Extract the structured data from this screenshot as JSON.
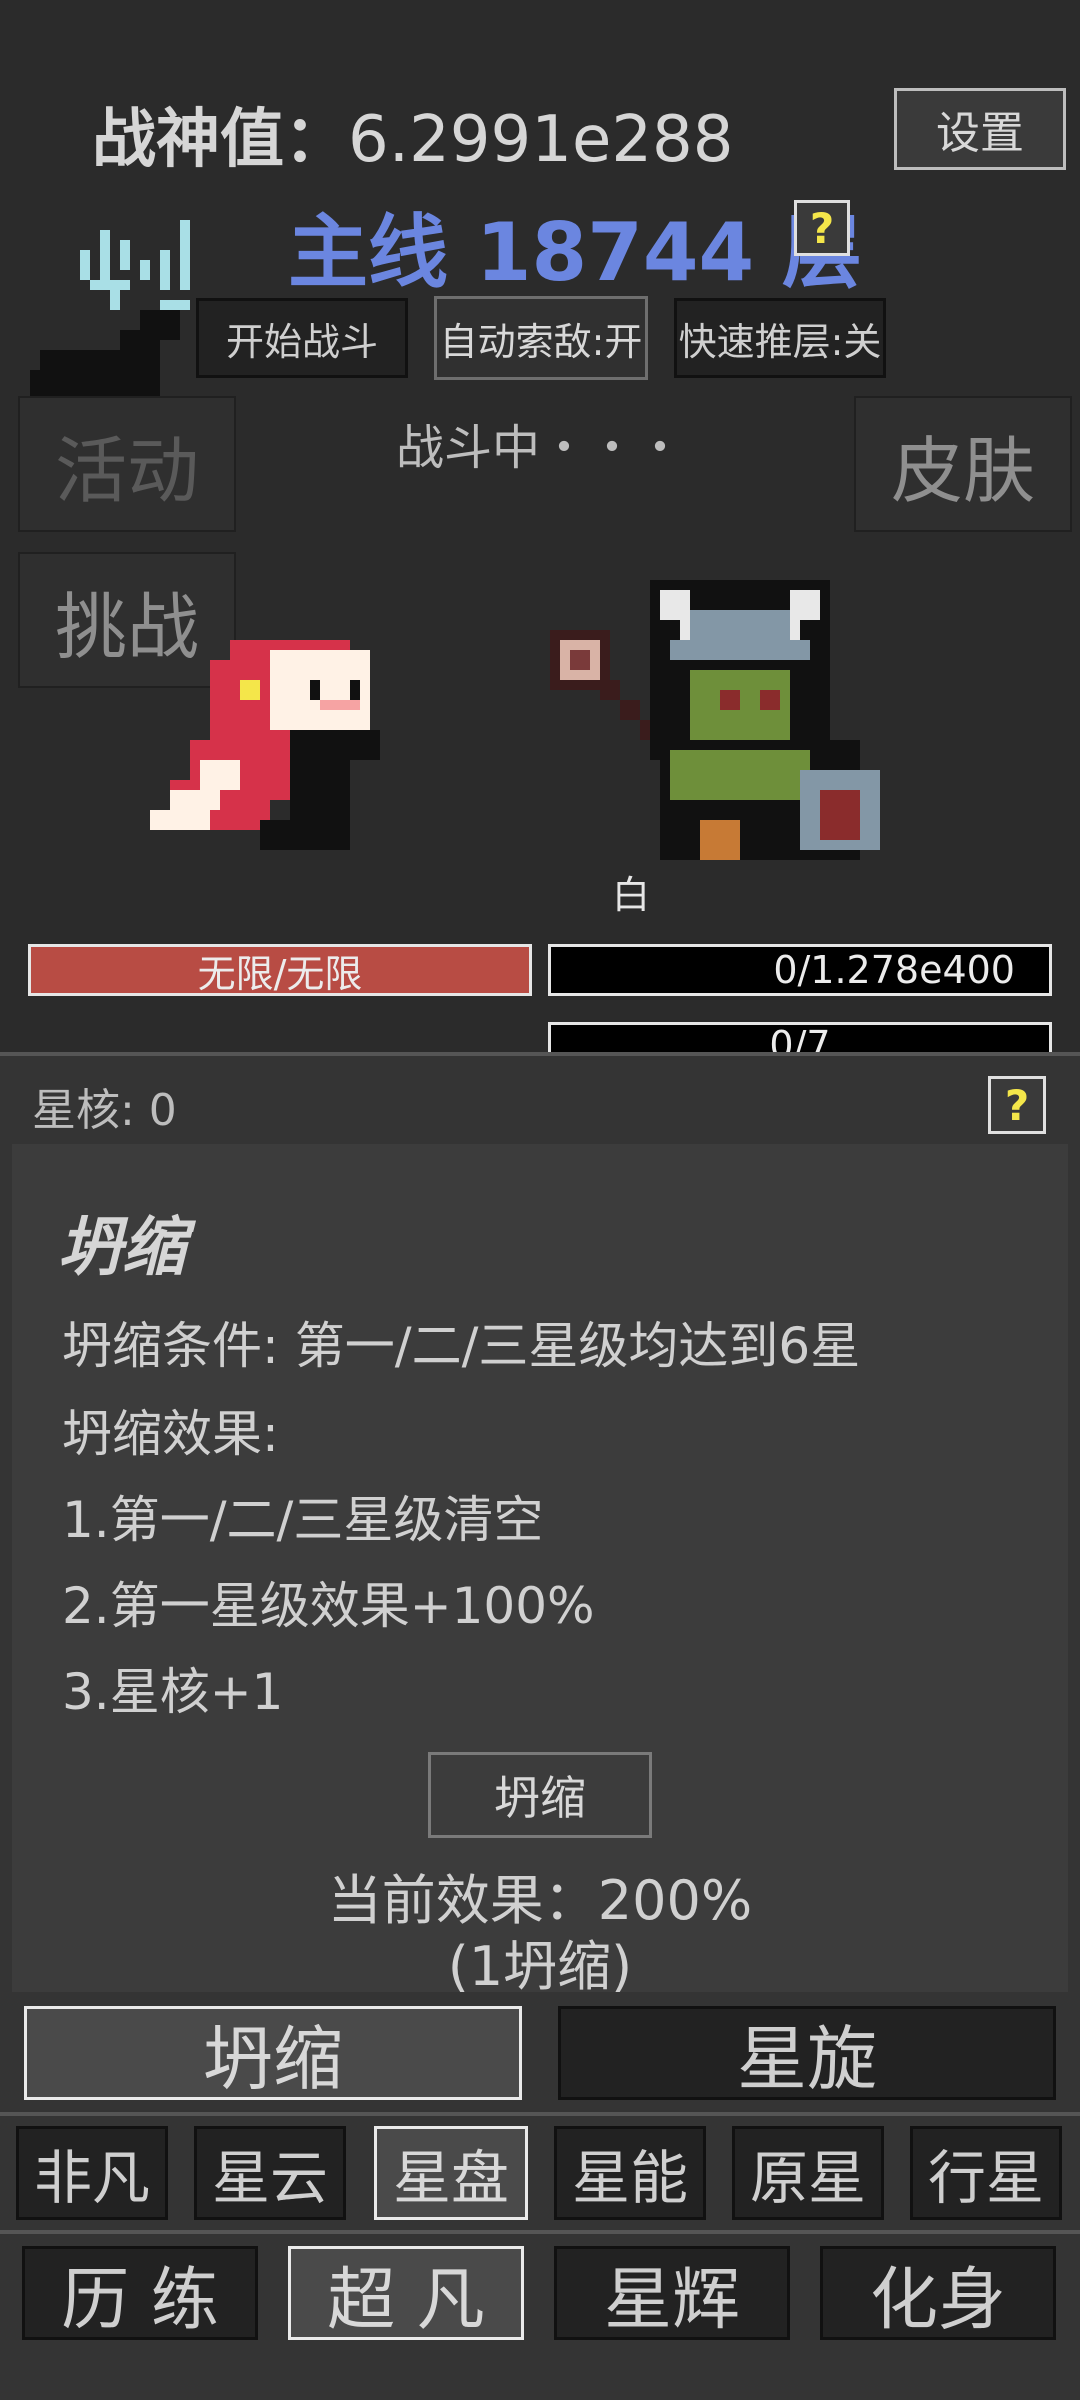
{
  "header": {
    "war_god_label": "战神值：",
    "war_god_value": "6.2991e288",
    "settings_button": "设置",
    "main_line_label": "主线",
    "level_number": "18744",
    "level_unit": "层",
    "help_glyph": "?"
  },
  "controls": {
    "start_battle": "开始战斗",
    "auto_search": "自动索敌:开",
    "fast_push": "快速推层:关"
  },
  "battle": {
    "status_text": "战斗中・・・",
    "left_ghost_button": "活动",
    "challenge_button": "挑战",
    "skin_button": "皮肤",
    "enemy_name": "白",
    "player_hp": "无限/无限",
    "enemy_hp": "0/1.278e400",
    "enemy_secondary": "0/7"
  },
  "panel": {
    "star_core_label": "星核: 0",
    "help_glyph": "?",
    "title": "坍缩",
    "condition": "坍缩条件: 第一/二/三星级均达到6星",
    "effect_label": "坍缩效果:",
    "effects": [
      "1.第一/二/三星级清空",
      "2.第一星级效果+100%",
      "3.星核+1"
    ],
    "collapse_button": "坍缩",
    "current_effect": "当前效果：200%",
    "collapse_count": "(1坍缩)"
  },
  "subtabs": {
    "collapse": "坍缩",
    "spin": "星旋"
  },
  "star_tabs": [
    "非凡",
    "星云",
    "星盘",
    "星能",
    "原星",
    "行星"
  ],
  "bottom_tabs": [
    "历 练",
    "超 凡",
    "星辉",
    "化身"
  ],
  "colors": {
    "background": "#2b2b2b",
    "panel": "#3a3a3a",
    "level_blue": "#6b86e0",
    "hp_red": "#b84c44",
    "help_yellow": "#f4e64a"
  }
}
